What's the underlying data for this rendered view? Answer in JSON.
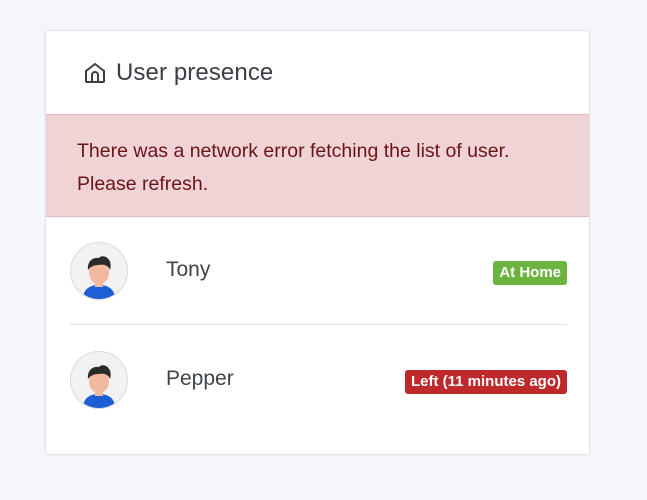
{
  "card": {
    "title": "User presence",
    "title_icon": "home-icon"
  },
  "alert": {
    "line1": "There was a network error fetching the list of user.",
    "line2": "Please refresh."
  },
  "users": [
    {
      "name": "Tony",
      "status": "At Home",
      "status_color": "#6db33f",
      "avatar_icon": "user-avatar-icon"
    },
    {
      "name": "Pepper",
      "status": "Left (11 minutes ago)",
      "status_color": "#c0292b",
      "avatar_icon": "user-avatar-icon"
    }
  ],
  "colors": {
    "alert_bg": "#f0d3d4",
    "alert_text": "#6b1418",
    "page_bg": "#f5f6fa"
  }
}
